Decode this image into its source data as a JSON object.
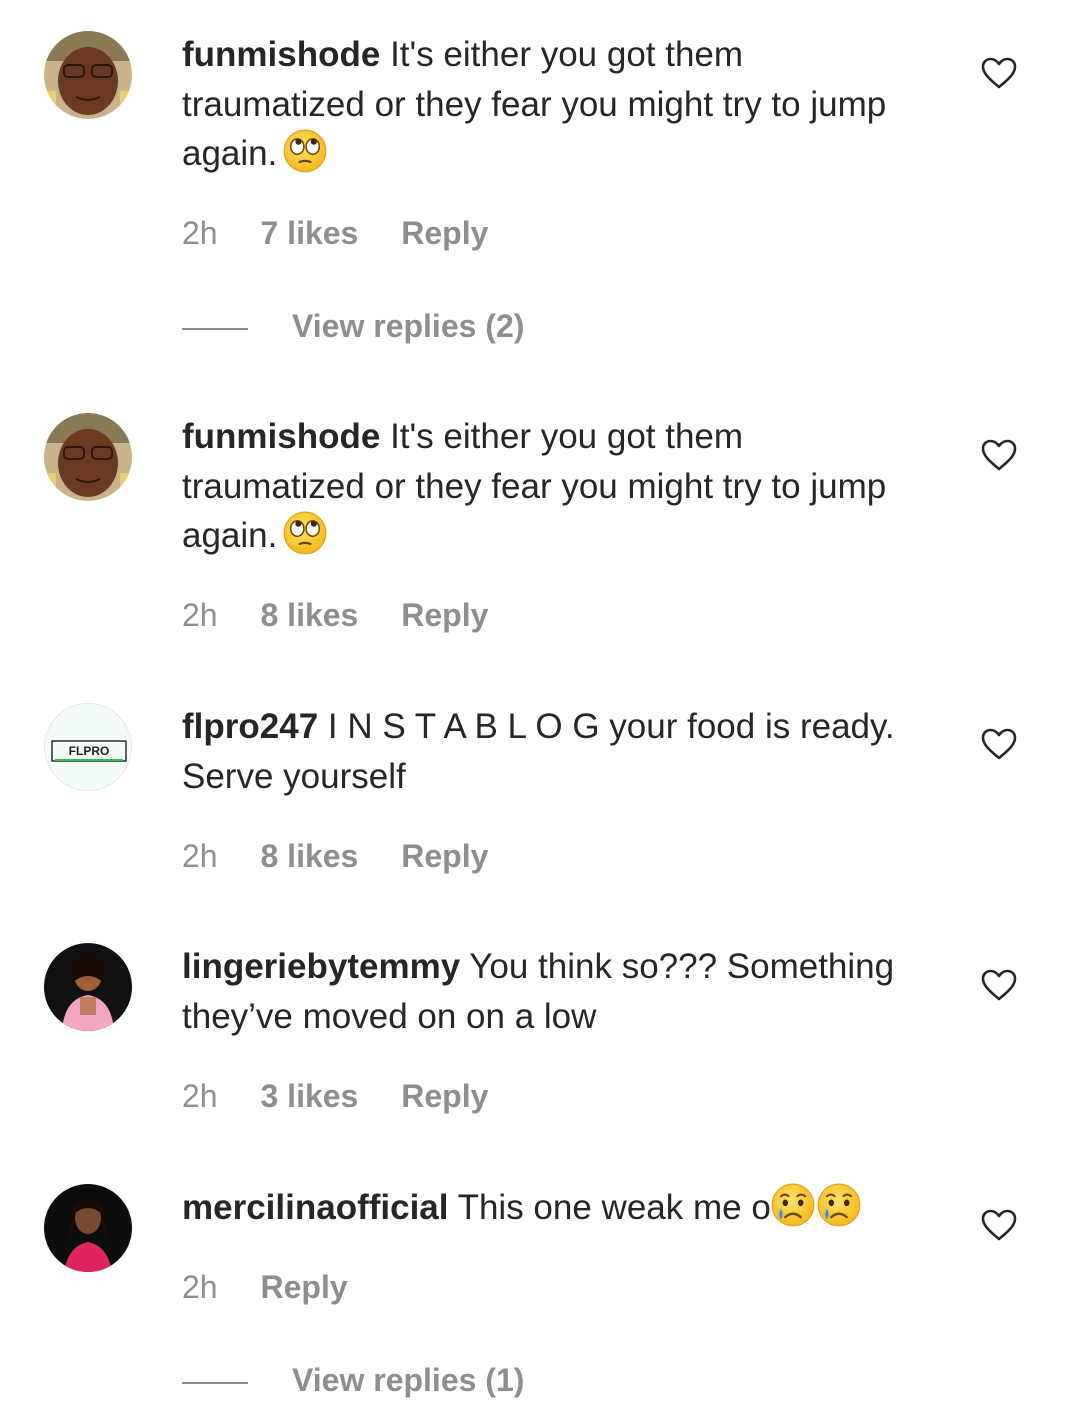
{
  "comments": [
    {
      "username": "funmishode",
      "text": "It's either you got them traumatized or they fear you might try to jump again.",
      "emojis": [
        "face-with-rolling-eyes"
      ],
      "time": "2h",
      "likes": "7 likes",
      "reply": "Reply",
      "view_replies": "View replies (2)",
      "avatar": "funmishode-avatar"
    },
    {
      "username": "funmishode",
      "text": "It's either you got them traumatized or they fear you might try to jump again.",
      "emojis": [
        "face-with-rolling-eyes"
      ],
      "time": "2h",
      "likes": "8 likes",
      "reply": "Reply",
      "avatar": "funmishode-avatar"
    },
    {
      "username": "flpro247",
      "text": "I N S T A B L O G your food is ready. Serve yourself",
      "emojis": [],
      "time": "2h",
      "likes": "8 likes",
      "reply": "Reply",
      "avatar": "flpro-logo-avatar",
      "avatar_logo_text": "FLPRO"
    },
    {
      "username": "lingeriebytemmy",
      "text": "You think so??? Something they’ve moved on on a low",
      "emojis": [],
      "time": "2h",
      "likes": "3 likes",
      "reply": "Reply",
      "avatar": "lingeriebytemmy-avatar"
    },
    {
      "username": "mercilinaofficial",
      "text": "This one weak me o",
      "emojis": [
        "crying-face",
        "crying-face"
      ],
      "time": "2h",
      "reply": "Reply",
      "view_replies": "View replies (1)",
      "avatar": "mercilinaofficial-avatar"
    }
  ],
  "icons": {
    "like": "heart-outline-icon"
  },
  "colors": {
    "text": "#262626",
    "muted": "#8e8e8e",
    "background": "#ffffff"
  }
}
